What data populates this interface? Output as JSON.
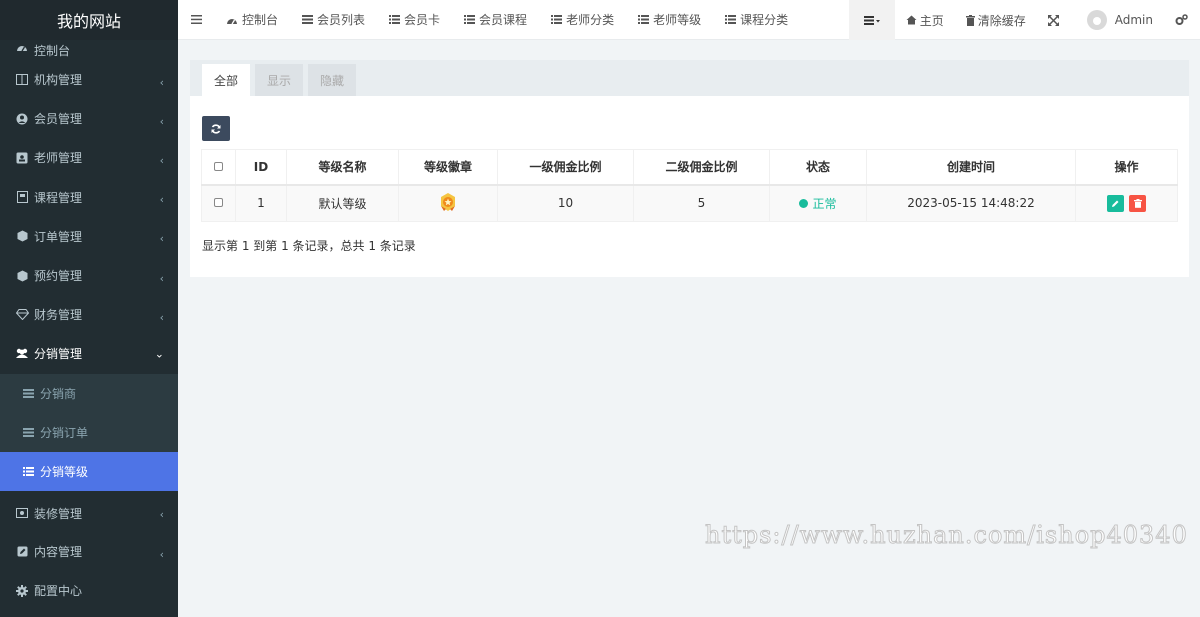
{
  "app": {
    "title": "我的网站"
  },
  "sidebar": {
    "items": [
      {
        "label": "控制台",
        "icon": "dashboard-icon"
      },
      {
        "label": "机构管理",
        "icon": "columns-icon"
      },
      {
        "label": "会员管理",
        "icon": "user-circle-icon"
      },
      {
        "label": "老师管理",
        "icon": "address-card-icon"
      },
      {
        "label": "课程管理",
        "icon": "book-icon"
      },
      {
        "label": "订单管理",
        "icon": "cube-icon"
      },
      {
        "label": "预约管理",
        "icon": "cube-icon"
      },
      {
        "label": "财务管理",
        "icon": "diamond-icon"
      },
      {
        "label": "分销管理",
        "icon": "users-icon"
      }
    ],
    "sub_items": [
      {
        "label": "分销商"
      },
      {
        "label": "分销订单"
      },
      {
        "label": "分销等级"
      }
    ],
    "bottom_items": [
      {
        "label": "装修管理",
        "icon": "picture-icon"
      },
      {
        "label": "内容管理",
        "icon": "edit-icon"
      },
      {
        "label": "配置中心",
        "icon": "gear-icon"
      }
    ]
  },
  "topbar": {
    "tabs": [
      {
        "label": "控制台"
      },
      {
        "label": "会员列表"
      },
      {
        "label": "会员卡"
      },
      {
        "label": "会员课程"
      },
      {
        "label": "老师分类"
      },
      {
        "label": "老师等级"
      },
      {
        "label": "课程分类"
      }
    ],
    "home": "主页",
    "clear_cache": "清除缓存",
    "user": "Admin"
  },
  "panel": {
    "tabs": [
      {
        "label": "全部"
      },
      {
        "label": "显示"
      },
      {
        "label": "隐藏"
      }
    ]
  },
  "table": {
    "headers": [
      "ID",
      "等级名称",
      "等级徽章",
      "一级佣金比例",
      "二级佣金比例",
      "状态",
      "创建时间",
      "操作"
    ],
    "rows": [
      {
        "id": "1",
        "name": "默认等级",
        "rate1": "10",
        "rate2": "5",
        "status": "正常",
        "created": "2023-05-15 14:48:22"
      }
    ]
  },
  "summary": "显示第 1 到第 1 条记录，总共 1 条记录",
  "watermark": "https://www.huzhan.com/ishop40340",
  "colors": {
    "sidebar_bg": "#222d32",
    "active": "#4e74e6",
    "success": "#18bc9c",
    "danger": "#f75444"
  }
}
